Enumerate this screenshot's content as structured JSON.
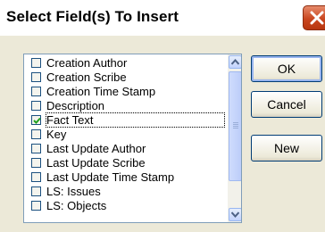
{
  "dialog": {
    "title": "Select Field(s) To Insert",
    "close_icon": "close-icon"
  },
  "fields": [
    {
      "label": "Creation Author",
      "checked": false
    },
    {
      "label": "Creation Scribe",
      "checked": false
    },
    {
      "label": "Creation Time Stamp",
      "checked": false
    },
    {
      "label": "Description",
      "checked": false
    },
    {
      "label": "Fact Text",
      "checked": true
    },
    {
      "label": "Key",
      "checked": false
    },
    {
      "label": "Last Update Author",
      "checked": false
    },
    {
      "label": "Last Update Scribe",
      "checked": false
    },
    {
      "label": "Last Update Time Stamp",
      "checked": false
    },
    {
      "label": "LS: Issues",
      "checked": false
    },
    {
      "label": "LS: Objects",
      "checked": false
    }
  ],
  "buttons": {
    "ok": "OK",
    "cancel": "Cancel",
    "new": "New"
  },
  "colors": {
    "title_bar": "#ffffff",
    "dialog_bg": "#ece9d8",
    "close_button": "#c9461f",
    "check_mark": "#21a121"
  }
}
